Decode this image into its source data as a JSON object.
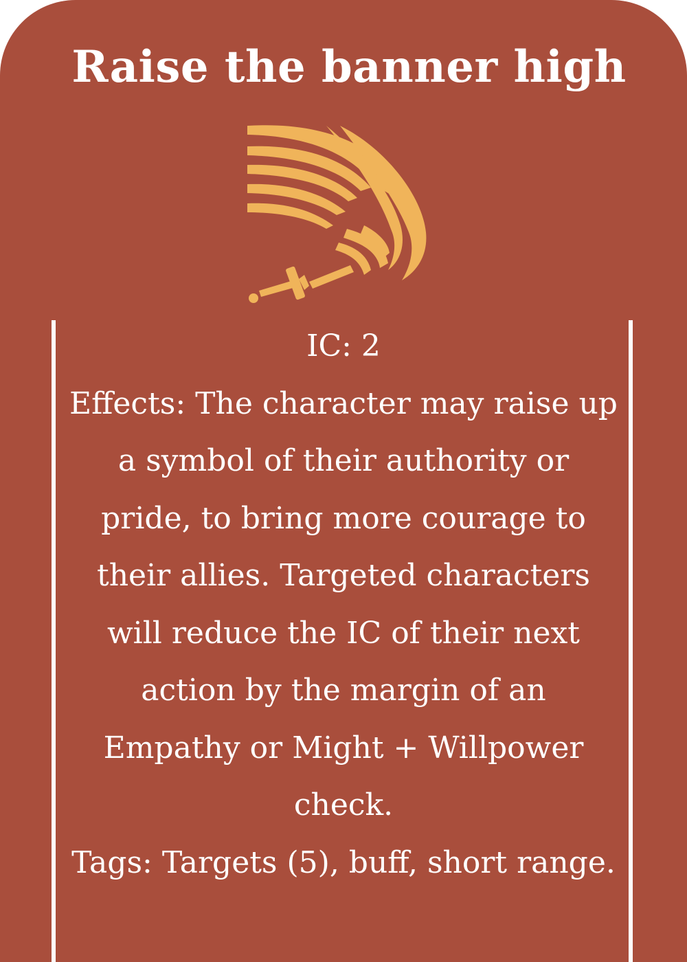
{
  "card": {
    "title": "Raise the banner high",
    "emblem_icon": "waving-banner-icon",
    "ic": "IC: 2",
    "effects": "Effects: The character may raise up a symbol of their authority or pride, to bring more courage to their allies. Targeted characters will reduce the IC of their next action by the margin of an Empathy or Might + Willpower check.",
    "tags": "Tags: Targets (5), buff, short range."
  },
  "colors": {
    "card_background": "#a94e3c",
    "text": "#ffffff",
    "emblem": "#f0b45a"
  }
}
